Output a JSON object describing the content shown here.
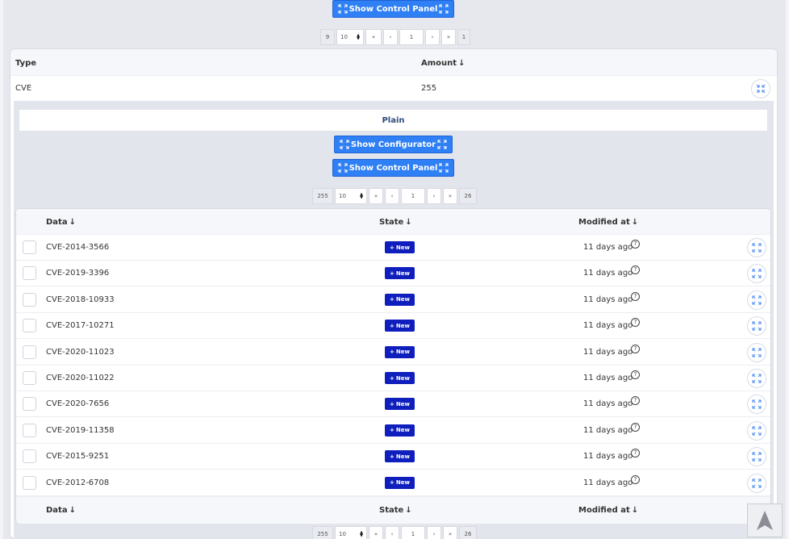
{
  "top": {
    "control_panel_label": "Show Control Panel",
    "pager": {
      "total": "9",
      "per_page": "10",
      "first": "«",
      "prev": "‹",
      "page": "1",
      "next": "›",
      "last": "»",
      "pages": "1"
    }
  },
  "outer_table": {
    "headers": {
      "type": "Type",
      "amount": "Amount"
    },
    "row": {
      "type": "CVE",
      "amount": "255"
    }
  },
  "detail": {
    "plain_tab": "Plain",
    "configurator_label": "Show Configurator",
    "control_panel_label": "Show Control Panel",
    "pager": {
      "total": "255",
      "per_page": "10",
      "first": "«",
      "prev": "‹",
      "page": "1",
      "next": "›",
      "last": "»",
      "pages": "26"
    }
  },
  "inner_table": {
    "headers": {
      "data": "Data",
      "state": "State",
      "modified": "Modified at"
    },
    "rows": [
      {
        "id": "CVE-2014-3566",
        "state": "New",
        "modified": "11 days ago"
      },
      {
        "id": "CVE-2019-3396",
        "state": "New",
        "modified": "11 days ago"
      },
      {
        "id": "CVE-2018-10933",
        "state": "New",
        "modified": "11 days ago"
      },
      {
        "id": "CVE-2017-10271",
        "state": "New",
        "modified": "11 days ago"
      },
      {
        "id": "CVE-2020-11023",
        "state": "New",
        "modified": "11 days ago"
      },
      {
        "id": "CVE-2020-11022",
        "state": "New",
        "modified": "11 days ago"
      },
      {
        "id": "CVE-2020-7656",
        "state": "New",
        "modified": "11 days ago"
      },
      {
        "id": "CVE-2019-11358",
        "state": "New",
        "modified": "11 days ago"
      },
      {
        "id": "CVE-2015-9251",
        "state": "New",
        "modified": "11 days ago"
      },
      {
        "id": "CVE-2012-6708",
        "state": "New",
        "modified": "11 days ago"
      }
    ],
    "footer": {
      "data": "Data",
      "state": "State",
      "modified": "Modified at"
    }
  },
  "bottom_pager": {
    "total": "255",
    "per_page": "10",
    "first": "«",
    "prev": "‹",
    "page": "1",
    "next": "›",
    "last": "»",
    "pages": "26"
  },
  "icons": {
    "expand": "expand-icon",
    "collapse": "collapse-icon",
    "question": "question-icon",
    "sort_down": "arrow-down-icon",
    "scroll_up": "scroll-up-icon"
  },
  "colors": {
    "primary_button": "#2f7ff5",
    "state_badge": "#0f1fbd"
  }
}
